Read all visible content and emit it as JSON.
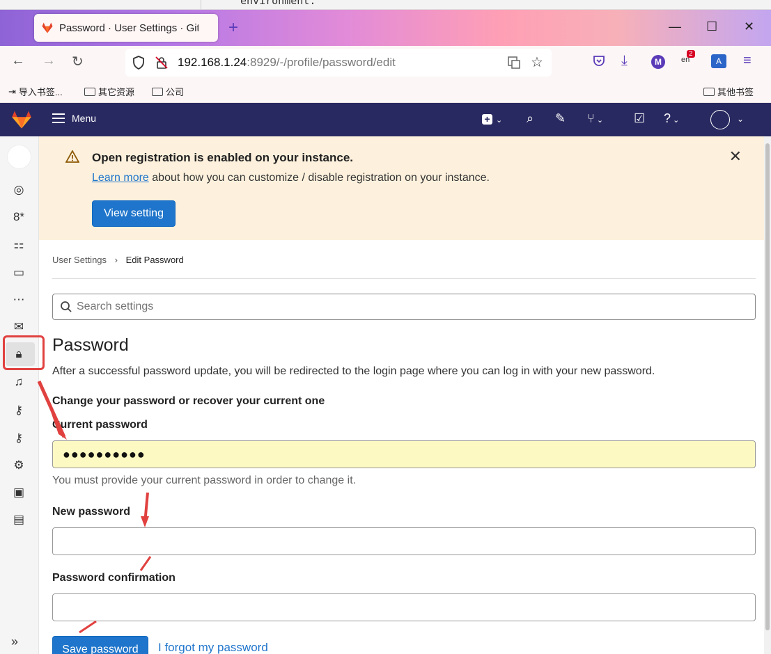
{
  "background": {
    "code_snippet": "environment."
  },
  "browser": {
    "tab_title": "Password · User Settings · Git",
    "url_host": "192.168.1.24",
    "url_path": ":8929/-/profile/password/edit",
    "extension_badge": "2",
    "extension_avatar": "M",
    "bookmarks": [
      "导入书签...",
      "其它资源",
      "公司"
    ],
    "bookmarks_right": "其他书签"
  },
  "gitlab": {
    "menu_label": "Menu"
  },
  "banner": {
    "title": "Open registration is enabled on your instance.",
    "link": "Learn more",
    "body": " about how you can customize / disable registration on your instance.",
    "button": "View setting"
  },
  "breadcrumb": {
    "parent": "User Settings",
    "current": "Edit Password"
  },
  "search": {
    "placeholder": "Search settings"
  },
  "page": {
    "title": "Password",
    "description": "After a successful password update, you will be redirected to the login page where you can log in with your new password.",
    "subtitle": "Change your password or recover your current one",
    "current_label": "Current password",
    "current_value": "●●●●●●●●●●",
    "current_help": "You must provide your current password in order to change it.",
    "new_label": "New password",
    "confirm_label": "Password confirmation",
    "save_button": "Save password",
    "forgot_link": "I forgot my password"
  },
  "colors": {
    "accent": "#1f75cb",
    "header": "#292961",
    "highlight": "#e0413f",
    "banner": "#fdf1dd"
  }
}
